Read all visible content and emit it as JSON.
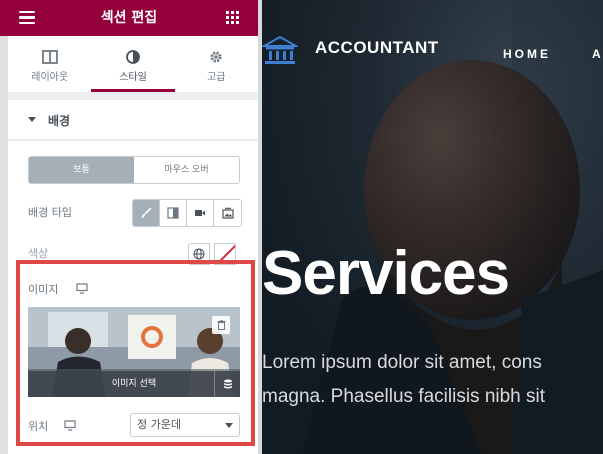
{
  "panel": {
    "title": "섹션 편집",
    "tabs": [
      {
        "label": "레이아웃",
        "icon": "layout-icon"
      },
      {
        "label": "스타일",
        "icon": "style-icon"
      },
      {
        "label": "고급",
        "icon": "gear-icon"
      }
    ],
    "active_tab": "스타일",
    "accent_color": "#93003c"
  },
  "section": {
    "label": "배경",
    "state_switch": [
      "보통",
      "마우스 오버"
    ],
    "background_type_label": "배경 타입",
    "background_types": [
      "classic-brush-icon",
      "gradient-icon",
      "video-icon",
      "slideshow-icon"
    ],
    "color_label": "색상",
    "image_label": "이미지",
    "image_select_label": "이미지 선택",
    "position_label": "위치",
    "position_value": "정 가운데"
  },
  "site": {
    "brand": "ACCOUNTANT",
    "nav": [
      "HOME",
      "A"
    ],
    "hero_title": "Services",
    "hero_lines": [
      "Lorem ipsum dolor sit amet, cons",
      "magna. Phasellus facilisis nibh sit"
    ]
  },
  "colors": {
    "highlight": "#e04848",
    "switch_active": "#a4afb7"
  }
}
